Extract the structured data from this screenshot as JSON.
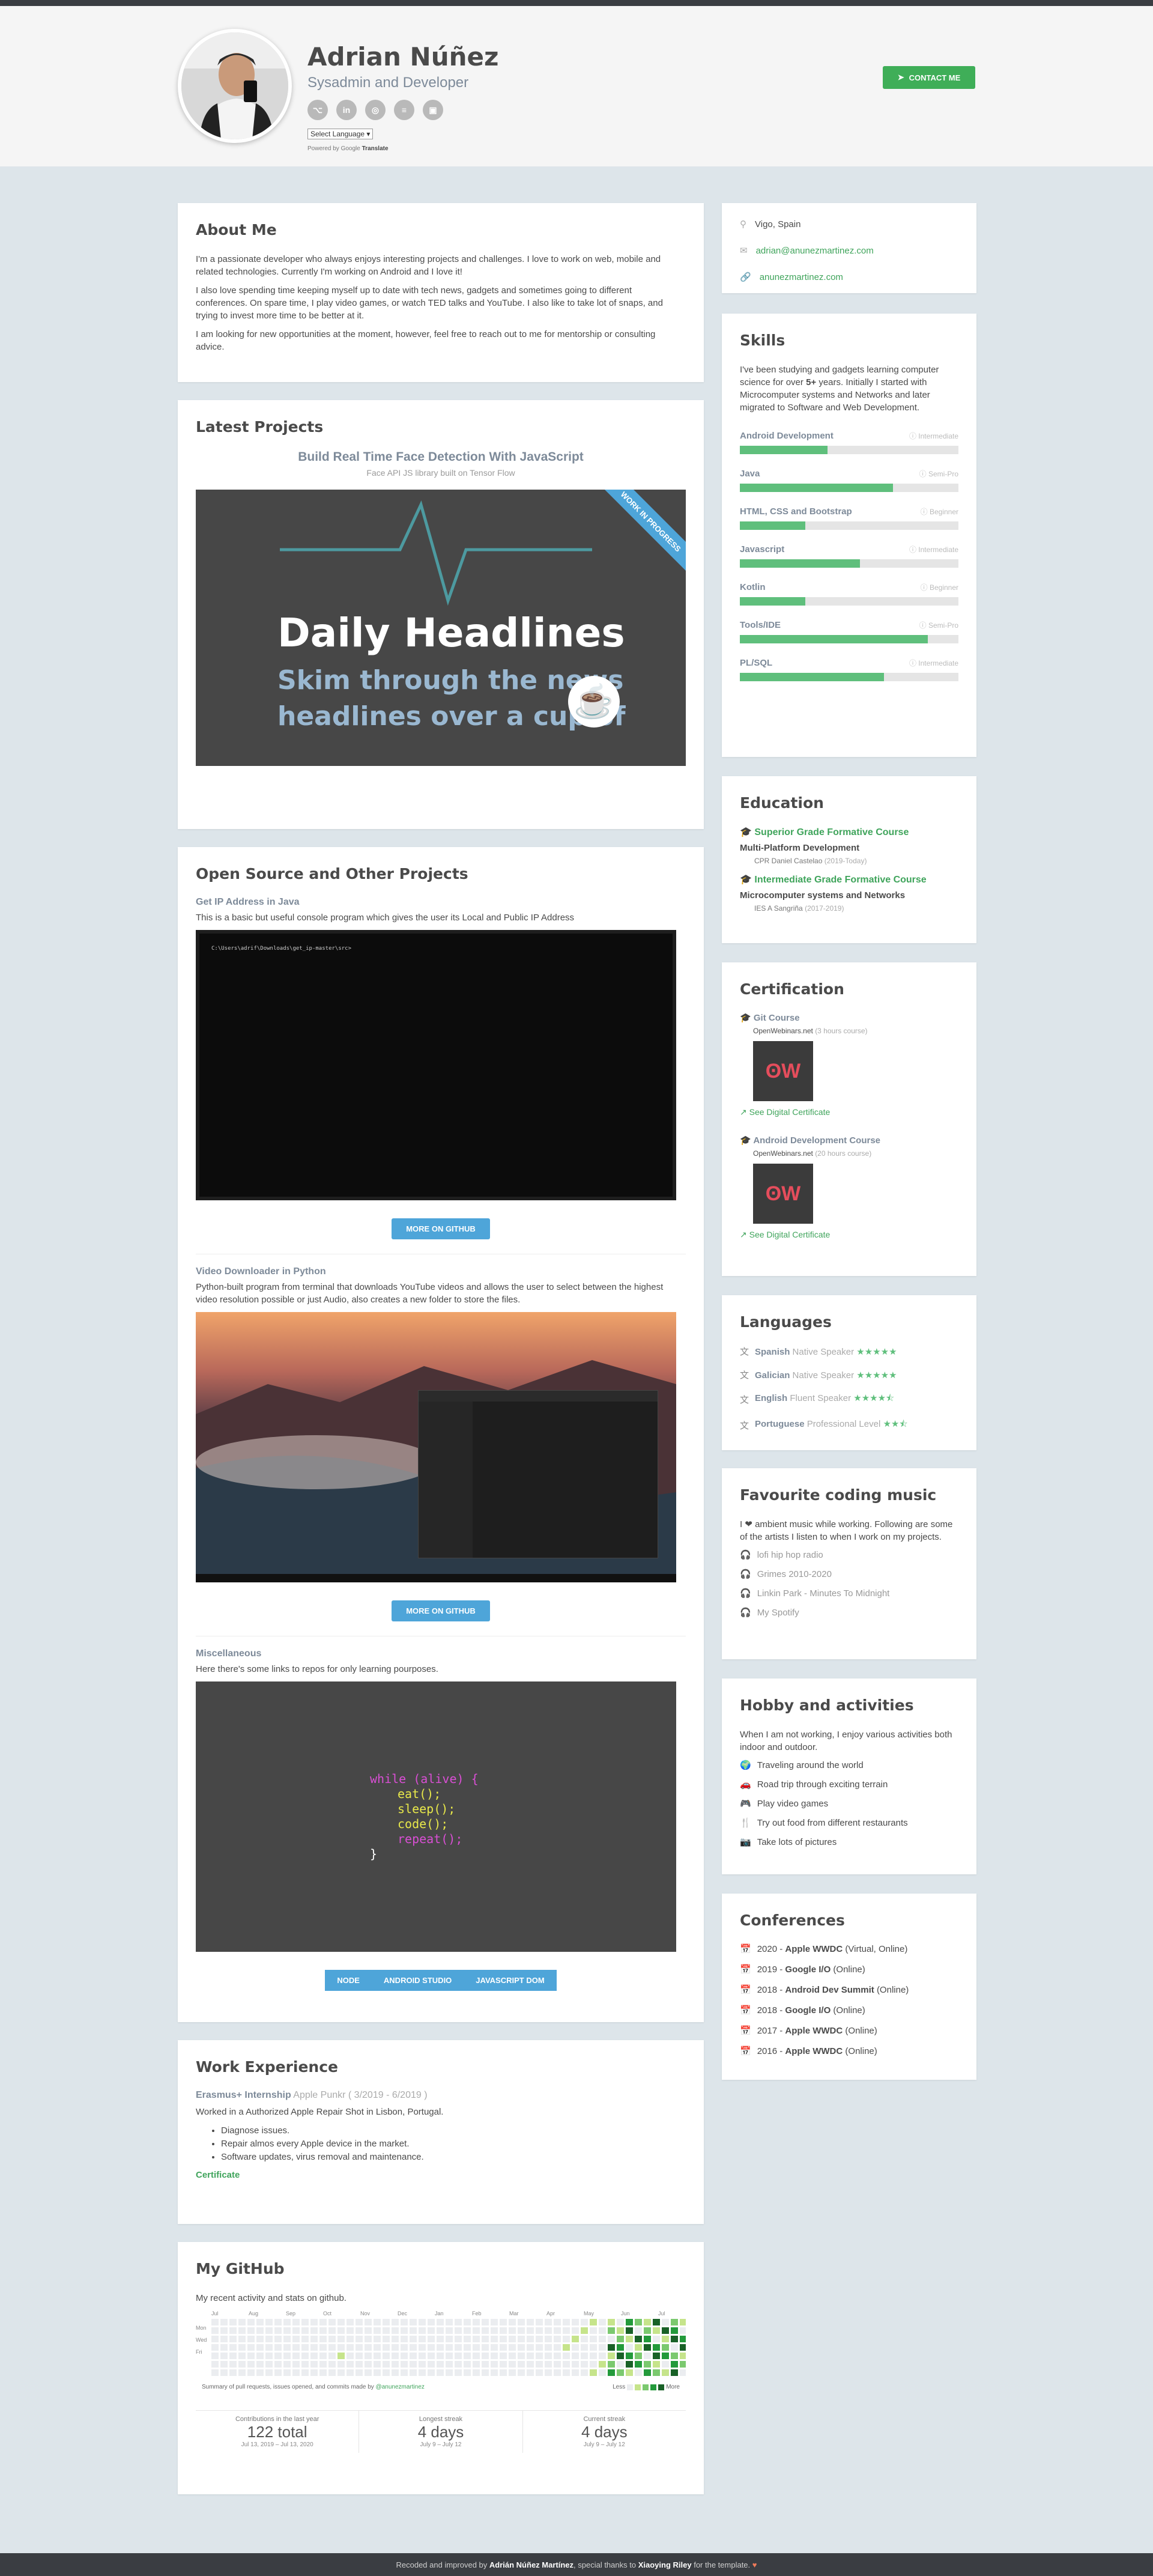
{
  "header": {
    "name": "Adrian Núñez",
    "title": "Sysadmin and Developer",
    "socials": [
      "github-icon",
      "linkedin-icon",
      "globe-icon",
      "stackoverflow-icon",
      "instagram-icon"
    ],
    "language_select": "Select Language",
    "powered_by": "Powered by",
    "google": "Google",
    "translate": "Translate",
    "contact_label": "CONTACT ME"
  },
  "about": {
    "heading": "About Me",
    "p1": "I'm a passionate developer who always enjoys interesting projects and challenges. I love to work on web, mobile and related technologies. Currently I'm working on Android and I love it!",
    "p2": "I also love spending time keeping myself up to date with tech news, gadgets and sometimes going to different conferences. On spare time, I play video games, or watch TED talks and YouTube. I also like to take lot of snaps, and trying to invest more time to be better at it.",
    "p3": "I am looking for new opportunities at the moment, however, feel free to reach out to me for mentorship or consulting advice."
  },
  "latest": {
    "heading": "Latest Projects",
    "project_title": "Build Real Time Face Detection With JavaScript",
    "project_sub": "Face API JS library built on Tensor Flow",
    "image_line1": "Daily Headlines",
    "image_line2": "Skim through the news",
    "image_line3": "headlines over a cup of",
    "ribbon": "WORK IN PROGRESS"
  },
  "opensource": {
    "heading": "Open Source and Other Projects",
    "p1_title": "Get IP Address in Java",
    "p1_desc": "This is a basic but useful console program which gives the user its Local and Public IP Address",
    "terminal_text": "C:\\Users\\adrif\\Downloads\\get_ip-master\\src>",
    "btn1": "MORE ON GITHUB",
    "p2_title": "Video Downloader in Python",
    "p2_desc": "Python-built program from terminal that downloads YouTube videos and allows the user to select between the highest video resolution possible or just Audio, also creates a new folder to store the files.",
    "btn2": "MORE ON GITHUB",
    "p3_title": "Miscellaneous",
    "p3_desc": "Here there's some links to repos for only learning pourposes.",
    "code_lines": [
      "while (alive) {",
      "eat();",
      "sleep();",
      "code();",
      "repeat();",
      "}"
    ],
    "tags": [
      "NODE",
      "ANDROID STUDIO",
      "JAVASCRIPT DOM"
    ]
  },
  "work": {
    "heading": "Work Experience",
    "job": "Erasmus+ Internship",
    "company": "Apple Punkr",
    "dates": "( 3/2019 - 6/2019 )",
    "desc": "Worked in a Authorized Apple Repair Shot in Lisbon, Portugal.",
    "bullets": [
      "Diagnose issues.",
      "Repair almos every Apple device in the market.",
      "Software updates, virus removal and maintenance."
    ],
    "cert_link": "Certificate"
  },
  "github": {
    "heading": "My GitHub",
    "desc": "My recent activity and stats on github.",
    "months": [
      "Jul",
      "Aug",
      "Sep",
      "Oct",
      "Nov",
      "Dec",
      "Jan",
      "Feb",
      "Mar",
      "Apr",
      "May",
      "Jun",
      "Jul"
    ],
    "days": [
      "Mon",
      "Wed",
      "Fri"
    ],
    "summary": "Summary of pull requests, issues opened, and commits made by",
    "user": "@anunezmartinez",
    "less": "Less",
    "more": "More",
    "stats": [
      {
        "label": "Contributions in the last year",
        "value": "122 total",
        "range": "Jul 13, 2019 – Jul 13, 2020"
      },
      {
        "label": "Longest streak",
        "value": "4 days",
        "range": "July 9 – July 12"
      },
      {
        "label": "Current streak",
        "value": "4 days",
        "range": "July 9 – July 12"
      }
    ]
  },
  "contact": {
    "location": "Vigo, Spain",
    "email": "adrian@anunezmartinez.com",
    "website": "anunezmartinez.com"
  },
  "skills": {
    "heading": "Skills",
    "intro_a": "I've been studying and gadgets learning computer science for over",
    "intro_b": "5+",
    "intro_c": "years. Initially I started with Microcomputer systems and Networks and later migrated to Software and Web Development.",
    "items": [
      {
        "name": "Android Development",
        "level": "Intermediate",
        "value": 0.4
      },
      {
        "name": "Java",
        "level": "Semi-Pro",
        "value": 0.7
      },
      {
        "name": "HTML, CSS and Bootstrap",
        "level": "Beginner",
        "value": 0.3
      },
      {
        "name": "Javascript",
        "level": "Intermediate",
        "value": 0.55
      },
      {
        "name": "Kotlin",
        "level": "Beginner",
        "value": 0.3
      },
      {
        "name": "Tools/IDE",
        "level": "Semi-Pro",
        "value": 0.86
      },
      {
        "name": "PL/SQL",
        "level": "Intermediate",
        "value": 0.66
      }
    ]
  },
  "education": {
    "heading": "Education",
    "items": [
      {
        "title": "Superior Grade Formative Course",
        "subject": "Multi-Platform Development",
        "school": "CPR Daniel Castelao",
        "years": "(2019-Today)"
      },
      {
        "title": "Intermediate Grade Formative Course",
        "subject": "Microcomputer systems and Networks",
        "school": "IES A Sangriña",
        "years": "(2017-2019)"
      }
    ]
  },
  "certification": {
    "heading": "Certification",
    "items": [
      {
        "title": "Git Course",
        "provider": "OpenWebinars.net",
        "hours": "(3 hours course)",
        "link": "See Digital Certificate"
      },
      {
        "title": "Android Development Course",
        "provider": "OpenWebinars.net",
        "hours": "(20 hours course)",
        "link": "See Digital Certificate"
      }
    ]
  },
  "languages": {
    "heading": "Languages",
    "items": [
      {
        "name": "Spanish",
        "level": "Native Speaker",
        "stars": 5
      },
      {
        "name": "Galician",
        "level": "Native Speaker",
        "stars": 5
      },
      {
        "name": "English",
        "level": "Fluent Speaker",
        "stars": 4.5
      },
      {
        "name": "Portuguese",
        "level": "Professional Level",
        "stars": 2.5
      }
    ]
  },
  "music": {
    "heading": "Favourite coding music",
    "intro": "I ❤ ambient music while working. Following are some of the artists I listen to when I work on my projects.",
    "items": [
      "lofi hip hop radio",
      "Grimes 2010-2020",
      "Linkin Park - Minutes To Midnight",
      "My Spotify"
    ]
  },
  "hobby": {
    "heading": "Hobby and activities",
    "intro": "When I am not working, I enjoy various activities both indoor and outdoor.",
    "items": [
      "Traveling around the world",
      "Road trip through exciting terrain",
      "Play video games",
      "Try out food from different restaurants",
      "Take lots of pictures"
    ]
  },
  "conferences": {
    "heading": "Conferences",
    "items": [
      {
        "year": "2020",
        "name": "Apple WWDC",
        "mode": "(Virtual, Online)"
      },
      {
        "year": "2019",
        "name": "Google I/O",
        "mode": "(Online)"
      },
      {
        "year": "2018",
        "name": "Android Dev Summit",
        "mode": "(Online)"
      },
      {
        "year": "2018",
        "name": "Google I/O",
        "mode": "(Online)"
      },
      {
        "year": "2017",
        "name": "Apple WWDC",
        "mode": "(Online)"
      },
      {
        "year": "2016",
        "name": "Apple WWDC",
        "mode": "(Online)"
      }
    ]
  },
  "footer": {
    "pre": "Recoded and improved by",
    "author": "Adrián Núñez Martínez",
    "mid": ", special thanks to",
    "thanks": "Xiaoying Riley",
    "post": "for the template."
  }
}
